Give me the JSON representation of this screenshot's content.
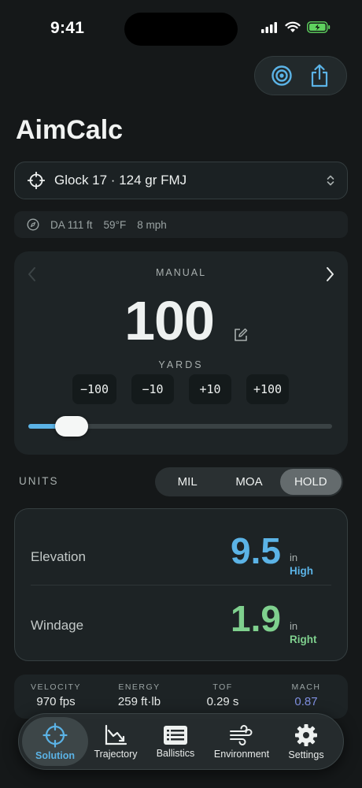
{
  "status": {
    "time": "9:41"
  },
  "app": {
    "title": "AimCalc"
  },
  "load": {
    "label": "Glock 17 · 124 gr FMJ"
  },
  "environment": {
    "density_altitude": "DA 111 ft",
    "temperature": "59°F",
    "wind": "8 mph"
  },
  "range": {
    "mode": "MANUAL",
    "value": "100",
    "unit": "YARDS",
    "steps": [
      "−100",
      "−10",
      "+10",
      "+100"
    ],
    "slider_fraction": 0.1
  },
  "units": {
    "label": "UNITS",
    "options": [
      "MIL",
      "MOA",
      "HOLD"
    ],
    "selected": "HOLD"
  },
  "solution": {
    "elevation": {
      "label": "Elevation",
      "value": "9.5",
      "unit": "in",
      "direction": "High",
      "color": "#5bb3e6"
    },
    "windage": {
      "label": "Windage",
      "value": "1.9",
      "unit": "in",
      "direction": "Right",
      "color": "#7fd08e"
    }
  },
  "stats": [
    {
      "key": "VELOCITY",
      "value": "970 fps"
    },
    {
      "key": "ENERGY",
      "value": "259 ft·lb"
    },
    {
      "key": "TOF",
      "value": "0.29 s"
    },
    {
      "key": "MACH",
      "value": "0.87",
      "color": "#7f8fe0"
    }
  ],
  "tabs": [
    {
      "label": "Solution",
      "icon": "crosshair-icon",
      "active": true
    },
    {
      "label": "Trajectory",
      "icon": "chart-icon"
    },
    {
      "label": "Ballistics",
      "icon": "table-icon"
    },
    {
      "label": "Environment",
      "icon": "wind-icon"
    },
    {
      "label": "Settings",
      "icon": "gear-icon"
    }
  ],
  "colors": {
    "accent": "#5bb3e6",
    "background": "#151819",
    "card": "#1e2426"
  }
}
